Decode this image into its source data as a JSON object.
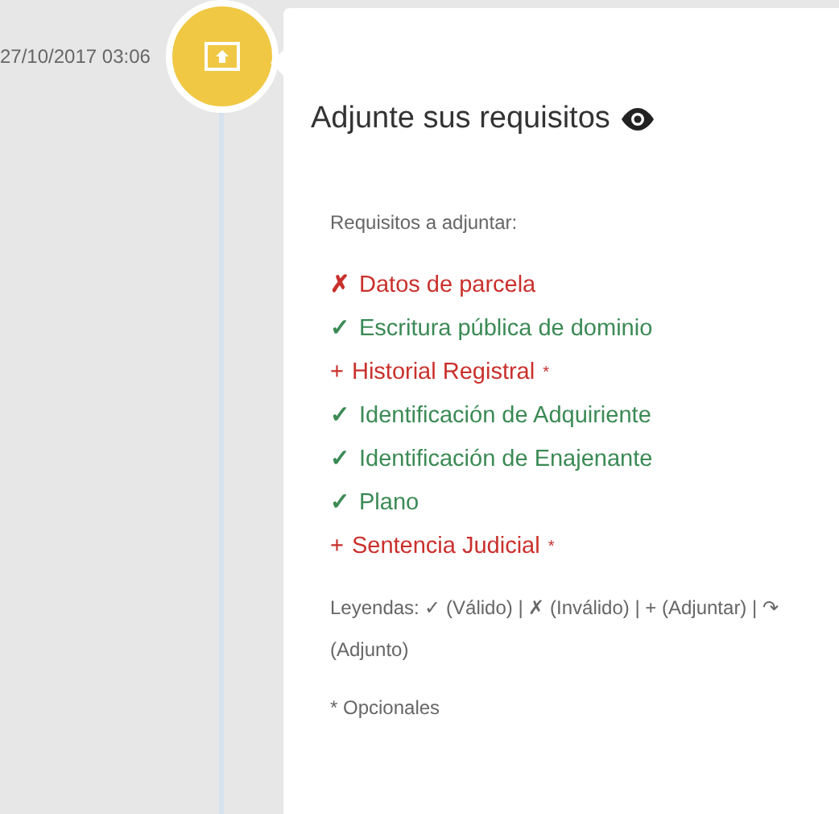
{
  "timeline": {
    "timestamp": "27/10/2017 03:06"
  },
  "card": {
    "title": "Adjunte sus requisitos",
    "subtitle": "Requisitos a adjuntar:",
    "requirements": [
      {
        "kind": "invalid",
        "mark": "✗",
        "label": "Datos de parcela"
      },
      {
        "kind": "valid",
        "mark": "✓",
        "label": "Escritura pública de dominio"
      },
      {
        "kind": "attach",
        "mark": "+",
        "label": "Historial Registral",
        "optional_mark": "*"
      },
      {
        "kind": "valid",
        "mark": "✓",
        "label": "Identificación de Adquiriente"
      },
      {
        "kind": "valid",
        "mark": "✓",
        "label": "Identificación de Enajenante"
      },
      {
        "kind": "valid",
        "mark": "✓",
        "label": "Plano"
      },
      {
        "kind": "attach",
        "mark": "+",
        "label": "Sentencia Judicial",
        "optional_mark": "*"
      }
    ],
    "legend": "Leyendas: ✓ (Válido) | ✗ (Inválido) | + (Adjuntar) | ↷ (Adjunto)",
    "note": "* Opcionales"
  }
}
